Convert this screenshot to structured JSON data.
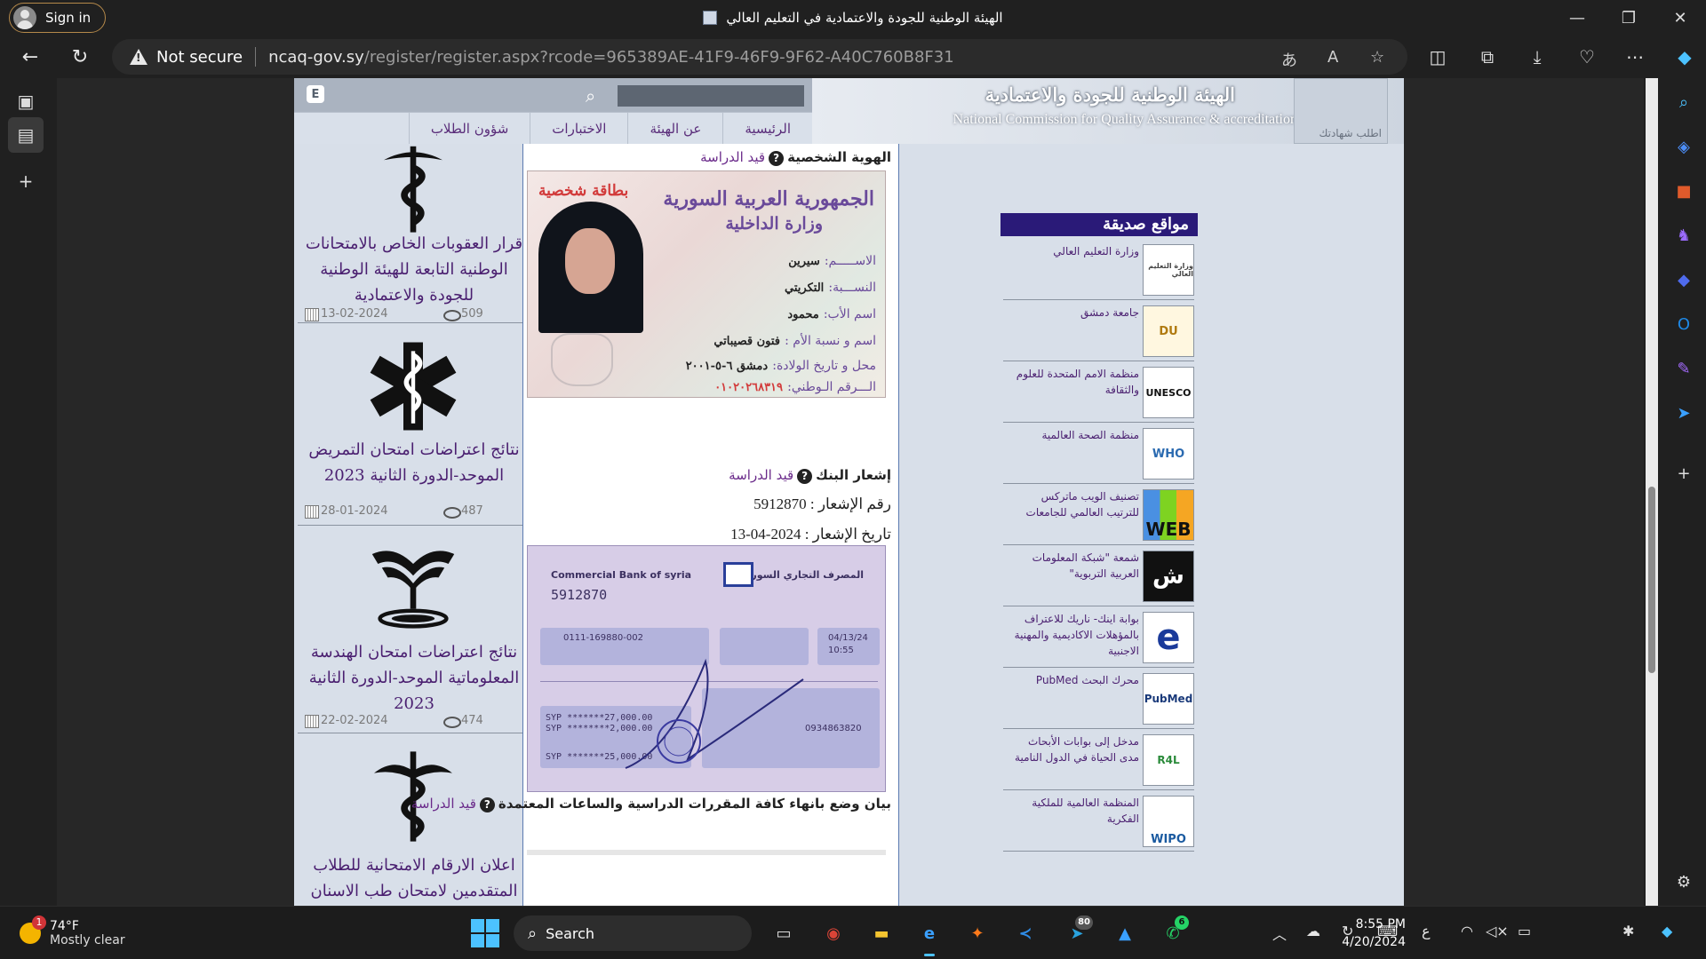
{
  "browser": {
    "sign_in": "Sign in",
    "tab_title": "الهيئة الوطنية للجودة والاعتمادية في التعليم العالي",
    "security": "Not secure",
    "url_host": "ncaq-gov.sy",
    "url_rest": "/register/register.aspx?rcode=965389AE-41F9-46F9-9F62-A40C760B8F31"
  },
  "site": {
    "org_name_ar": "الهيئة الوطنية للجودة والاعتمادية",
    "org_name_en": "National Commission for Quality Assurance & accreditation",
    "cert_label": "اطلب شهادتك",
    "e_button": "E",
    "menu": [
      "الرئيسية",
      "عن الهيئة",
      "الاختبارات",
      "شؤون الطلاب"
    ]
  },
  "news": [
    {
      "title": "قرار العقوبات الخاص بالامتحانات الوطنية التابعة للهيئة الوطنية للجودة والاعتمادية",
      "date": "13-02-2024",
      "views": "509",
      "icon": "caduceus-icon"
    },
    {
      "title": "نتائج اعتراضات امتحان التمريض الموحد-الدورة الثانية 2023",
      "date": "28-01-2024",
      "views": "487",
      "icon": "star-of-life-icon"
    },
    {
      "title": "نتائج اعتراضات امتحان الهندسة المعلوماتية الموحد-الدورة الثانية 2023",
      "date": "22-02-2024",
      "views": "474",
      "icon": "open-book-icon"
    },
    {
      "title": "اعلان الارقام الامتحانية للطلاب المتقدمين لامتحان طب الاسنان",
      "date": "",
      "views": "",
      "icon": "caduceus-icon"
    }
  ],
  "form": {
    "id_label": "الهوية الشخصية",
    "id_status": "قيد الدراسة",
    "bank_label": "إشعار البنك",
    "bank_status": "قيد الدراسة",
    "receipt_no_label": "رقم الإشعار :",
    "receipt_no": "5912870",
    "receipt_date_label": "تاريخ الإشعار :",
    "receipt_date": "2024-04-13",
    "courses_label": "بيان وضع بانهاء كافة المقررات الدراسية والساعات المعتمدة",
    "courses_status": "قيد الدراسة"
  },
  "id_card": {
    "country": "الجمهورية العربية السورية",
    "ministry": "وزارة الداخلية",
    "badge": "بطاقة شخصية",
    "rows": [
      {
        "label": "الاســـــم:",
        "value": "سيرين"
      },
      {
        "label": "النســـبة:",
        "value": "التكريتي"
      },
      {
        "label": "اسم الأب:",
        "value": "محمود"
      },
      {
        "label": "اسم و نسبة الأم :",
        "value": "فتون قصيباتي"
      },
      {
        "label": "محل و تاريخ الولادة:",
        "value": "دمشق ٦-٥-٢٠٠١"
      },
      {
        "label": "الـــرقم الـوطني:",
        "value": "٠١٠٢٠٢٦٨٣١٩"
      }
    ]
  },
  "receipt": {
    "bank_en": "Commercial Bank of syria",
    "bank_ar": "المصرف التجاري السوري",
    "number": "5912870",
    "account": "0111-169880-002",
    "amount1": "SYP  *******27,000.00",
    "amount2": "SYP  ********2,000.00",
    "amount3": "SYP  *******25,000.00",
    "date": "04/13/24",
    "time": "10:55",
    "phone": "0934863820"
  },
  "friends": {
    "heading": "مواقع صديقة",
    "items": [
      {
        "name": "وزارة التعليم العالي",
        "logo": "وزارة التعليم العالي"
      },
      {
        "name": "جامعة دمشق",
        "logo": "DU"
      },
      {
        "name": "منظمة الامم المتحدة للعلوم والثقافة",
        "logo": "UNESCO"
      },
      {
        "name": "منظمة الصحة العالمية",
        "logo": "WHO"
      },
      {
        "name": "تصنيف الويب ماتركس للترتيب العالمي للجامعات",
        "logo": "WEB"
      },
      {
        "name": "شمعة \"شبكة المعلومات العربية التربوية\"",
        "logo": "ش"
      },
      {
        "name": "بوابة اينك- ناريك للاعتراف بالمؤهلات الاكاديمية والمهنية الاجنبية",
        "logo": "e"
      },
      {
        "name": "محرك البحث PubMed",
        "logo": "PubMed"
      },
      {
        "name": "مدخل إلى بوابات الأبحاث مدى الحياة في الدول النامية",
        "logo": "R4L"
      },
      {
        "name": "المنظمة العالمية للملكية الفكرية",
        "logo": "WIPO"
      }
    ]
  },
  "taskbar": {
    "weather_temp": "74°F",
    "weather_desc": "Mostly clear",
    "weather_badge": "1",
    "search": "Search",
    "telegram_badge": "80",
    "whatsapp_badge": "6",
    "lang": "ع",
    "time": "8:55 PM",
    "date": "4/20/2024"
  }
}
